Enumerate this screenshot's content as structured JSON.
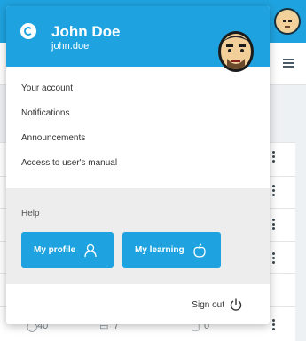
{
  "user": {
    "name": "John Doe",
    "login": "john.doe"
  },
  "menu": {
    "items": [
      {
        "label": "Your account"
      },
      {
        "label": "Notifications"
      },
      {
        "label": "Announcements"
      },
      {
        "label": "Access to user's manual"
      }
    ]
  },
  "help": {
    "label": "Help",
    "my_profile_label": "My profile",
    "my_learning_label": "My learning"
  },
  "signout": {
    "label": "Sign out"
  },
  "background": {
    "stats": [
      "40",
      "7",
      "0"
    ]
  },
  "colors": {
    "accent": "#1fa3e0",
    "help_bg": "#ededed"
  }
}
